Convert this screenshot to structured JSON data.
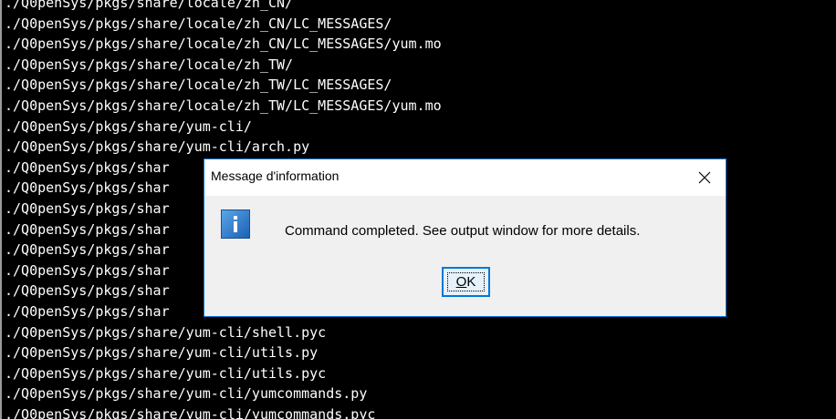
{
  "terminal": {
    "background": "#000000",
    "lines": [
      "./Q0penSys/pkgs/share/locale/zh_CN/",
      "./Q0penSys/pkgs/share/locale/zh_CN/LC_MESSAGES/",
      "./Q0penSys/pkgs/share/locale/zh_CN/LC_MESSAGES/yum.mo",
      "./Q0penSys/pkgs/share/locale/zh_TW/",
      "./Q0penSys/pkgs/share/locale/zh_TW/LC_MESSAGES/",
      "./Q0penSys/pkgs/share/locale/zh_TW/LC_MESSAGES/yum.mo",
      "./Q0penSys/pkgs/share/yum-cli/",
      "./Q0penSys/pkgs/share/yum-cli/arch.py",
      "./Q0penSys/pkgs/shar",
      "./Q0penSys/pkgs/shar",
      "./Q0penSys/pkgs/shar",
      "./Q0penSys/pkgs/shar",
      "./Q0penSys/pkgs/shar",
      "./Q0penSys/pkgs/shar",
      "./Q0penSys/pkgs/shar",
      "./Q0penSys/pkgs/shar",
      "./Q0penSys/pkgs/share/yum-cli/shell.pyc",
      "./Q0penSys/pkgs/share/yum-cli/utils.py",
      "./Q0penSys/pkgs/share/yum-cli/utils.pyc",
      "./Q0penSys/pkgs/share/yum-cli/yumcommands.py",
      "./Q0penSys/pkgs/share/yum-cli/yumcommands.pyc"
    ]
  },
  "dialog": {
    "title": "Message d'information",
    "close_icon": "close-x",
    "message_icon": "information-icon",
    "message": "Command completed. See output window for more details.",
    "ok_label": "OK",
    "accent": "#0078d7"
  }
}
